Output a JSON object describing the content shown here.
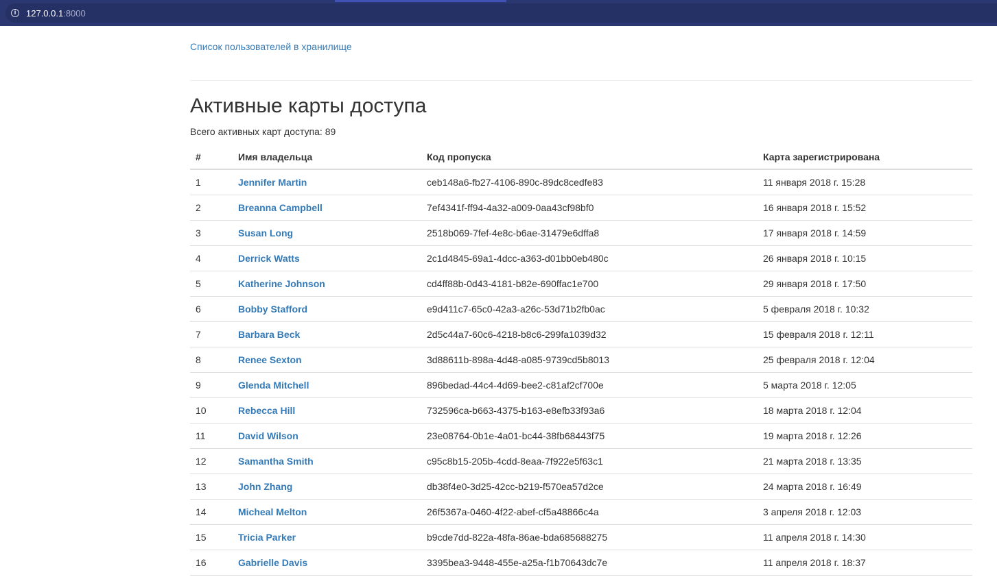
{
  "browser": {
    "url_host": "127.0.0.1",
    "url_port": ":8000"
  },
  "nav": {
    "users_link": "Список пользователей в хранилище"
  },
  "page": {
    "title": "Активные карты доступа",
    "summary": "Всего активных карт доступа: 89"
  },
  "table": {
    "headers": [
      "#",
      "Имя владельца",
      "Код пропуска",
      "Карта зарегистрирована"
    ],
    "rows": [
      {
        "num": "1",
        "owner": "Jennifer Martin",
        "code": "ceb148a6-fb27-4106-890c-89dc8cedfe83",
        "registered": "11 января 2018 г. 15:28"
      },
      {
        "num": "2",
        "owner": "Breanna Campbell",
        "code": "7ef4341f-ff94-4a32-a009-0aa43cf98bf0",
        "registered": "16 января 2018 г. 15:52"
      },
      {
        "num": "3",
        "owner": "Susan Long",
        "code": "2518b069-7fef-4e8c-b6ae-31479e6dffa8",
        "registered": "17 января 2018 г. 14:59"
      },
      {
        "num": "4",
        "owner": "Derrick Watts",
        "code": "2c1d4845-69a1-4dcc-a363-d01bb0eb480c",
        "registered": "26 января 2018 г. 10:15"
      },
      {
        "num": "5",
        "owner": "Katherine Johnson",
        "code": "cd4ff88b-0d43-4181-b82e-690ffac1e700",
        "registered": "29 января 2018 г. 17:50"
      },
      {
        "num": "6",
        "owner": "Bobby Stafford",
        "code": "e9d411c7-65c0-42a3-a26c-53d71b2fb0ac",
        "registered": "5 февраля 2018 г. 10:32"
      },
      {
        "num": "7",
        "owner": "Barbara Beck",
        "code": "2d5c44a7-60c6-4218-b8c6-299fa1039d32",
        "registered": "15 февраля 2018 г. 12:11"
      },
      {
        "num": "8",
        "owner": "Renee Sexton",
        "code": "3d88611b-898a-4d48-a085-9739cd5b8013",
        "registered": "25 февраля 2018 г. 12:04"
      },
      {
        "num": "9",
        "owner": "Glenda Mitchell",
        "code": "896bedad-44c4-4d69-bee2-c81af2cf700e",
        "registered": "5 марта 2018 г. 12:05"
      },
      {
        "num": "10",
        "owner": "Rebecca Hill",
        "code": "732596ca-b663-4375-b163-e8efb33f93a6",
        "registered": "18 марта 2018 г. 12:04"
      },
      {
        "num": "11",
        "owner": "David Wilson",
        "code": "23e08764-0b1e-4a01-bc44-38fb68443f75",
        "registered": "19 марта 2018 г. 12:26"
      },
      {
        "num": "12",
        "owner": "Samantha Smith",
        "code": "c95c8b15-205b-4cdd-8eaa-7f922e5f63c1",
        "registered": "21 марта 2018 г. 13:35"
      },
      {
        "num": "13",
        "owner": "John Zhang",
        "code": "db38f4e0-3d25-42cc-b219-f570ea57d2ce",
        "registered": "24 марта 2018 г. 16:49"
      },
      {
        "num": "14",
        "owner": "Micheal Melton",
        "code": "26f5367a-0460-4f22-abef-cf5a48866c4a",
        "registered": "3 апреля 2018 г. 12:03"
      },
      {
        "num": "15",
        "owner": "Tricia Parker",
        "code": "b9cde7dd-822a-48fa-86ae-bda685688275",
        "registered": "11 апреля 2018 г. 14:30"
      },
      {
        "num": "16",
        "owner": "Gabrielle Davis",
        "code": "3395bea3-9448-455e-a25a-f1b70643dc7e",
        "registered": "11 апреля 2018 г. 18:37"
      }
    ]
  },
  "colors": {
    "link": "#337ab7",
    "browser_bar": "#2b3770",
    "text": "#333333"
  },
  "icons": {
    "site_info": "info-icon"
  }
}
